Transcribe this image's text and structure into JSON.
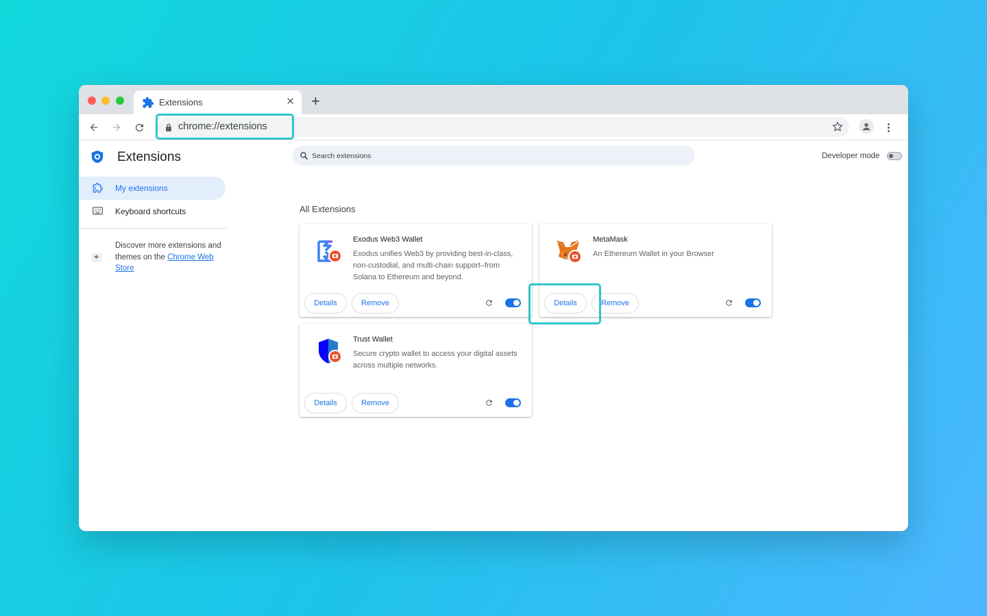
{
  "browser": {
    "tab": {
      "title": "Extensions"
    },
    "address_bar": {
      "url": "chrome://extensions"
    }
  },
  "page": {
    "title": "Extensions",
    "search": {
      "placeholder": "Search extensions"
    },
    "developer_mode": {
      "label": "Developer mode",
      "enabled": false
    }
  },
  "sidebar": {
    "items": [
      {
        "label": "My extensions",
        "active": true
      },
      {
        "label": "Keyboard shortcuts",
        "active": false
      }
    ],
    "discover": {
      "text": "Discover more extensions and themes on the",
      "link": "Chrome Web Store"
    }
  },
  "main": {
    "section_title": "All Extensions",
    "extensions": [
      {
        "name": "Exodus Web3 Wallet",
        "description": "Exodus unifies Web3 by providing best-in-class, non-custodial, and multi-chain support–from Solana to Ethereum and beyond.",
        "details_label": "Details",
        "remove_label": "Remove",
        "enabled": true
      },
      {
        "name": "MetaMask",
        "description": "An Ethereum Wallet in your Browser",
        "details_label": "Details",
        "remove_label": "Remove",
        "enabled": true
      },
      {
        "name": "Trust Wallet",
        "description": "Secure crypto wallet to access your digital assets across multiple networks.",
        "details_label": "Details",
        "remove_label": "Remove",
        "enabled": true
      }
    ]
  },
  "colors": {
    "accent": "#1a73e8",
    "highlight": "#2ec4c9",
    "badge": "#e8542c"
  }
}
